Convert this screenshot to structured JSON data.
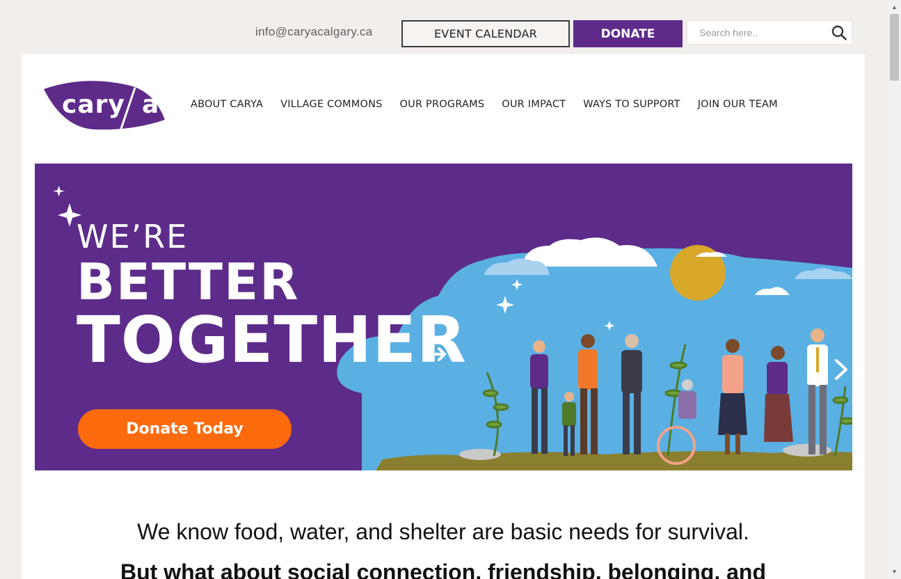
{
  "header": {
    "email": "info@caryacalgary.ca",
    "event_calendar_label": "EVENT CALENDAR",
    "donate_label": "DONATE",
    "search_placeholder": "Search here..",
    "search_icon": "search-icon"
  },
  "logo": {
    "text": "carya"
  },
  "nav": {
    "items": [
      {
        "label": "ABOUT CARYA"
      },
      {
        "label": "VILLAGE COMMONS"
      },
      {
        "label": "OUR PROGRAMS"
      },
      {
        "label": "OUR IMPACT"
      },
      {
        "label": "WAYS TO SUPPORT"
      },
      {
        "label": "JOIN OUR TEAM"
      }
    ]
  },
  "hero": {
    "line1": "WE’RE",
    "line2": "BETTER",
    "line3": "TOGETHER",
    "cta_label": "Donate Today",
    "prev_icon": "arrow-left-icon",
    "next_icon": "chevron-right-icon"
  },
  "content": {
    "intro": "We know food, water, and shelter are basic needs for survival.",
    "intro2": "But what about social connection, friendship, belonging, and"
  },
  "colors": {
    "brand_purple": "#5e2b8a",
    "donate_orange": "#fb6a0d",
    "sky_blue": "#5ab0e3",
    "page_bg": "#f2eeeb"
  }
}
